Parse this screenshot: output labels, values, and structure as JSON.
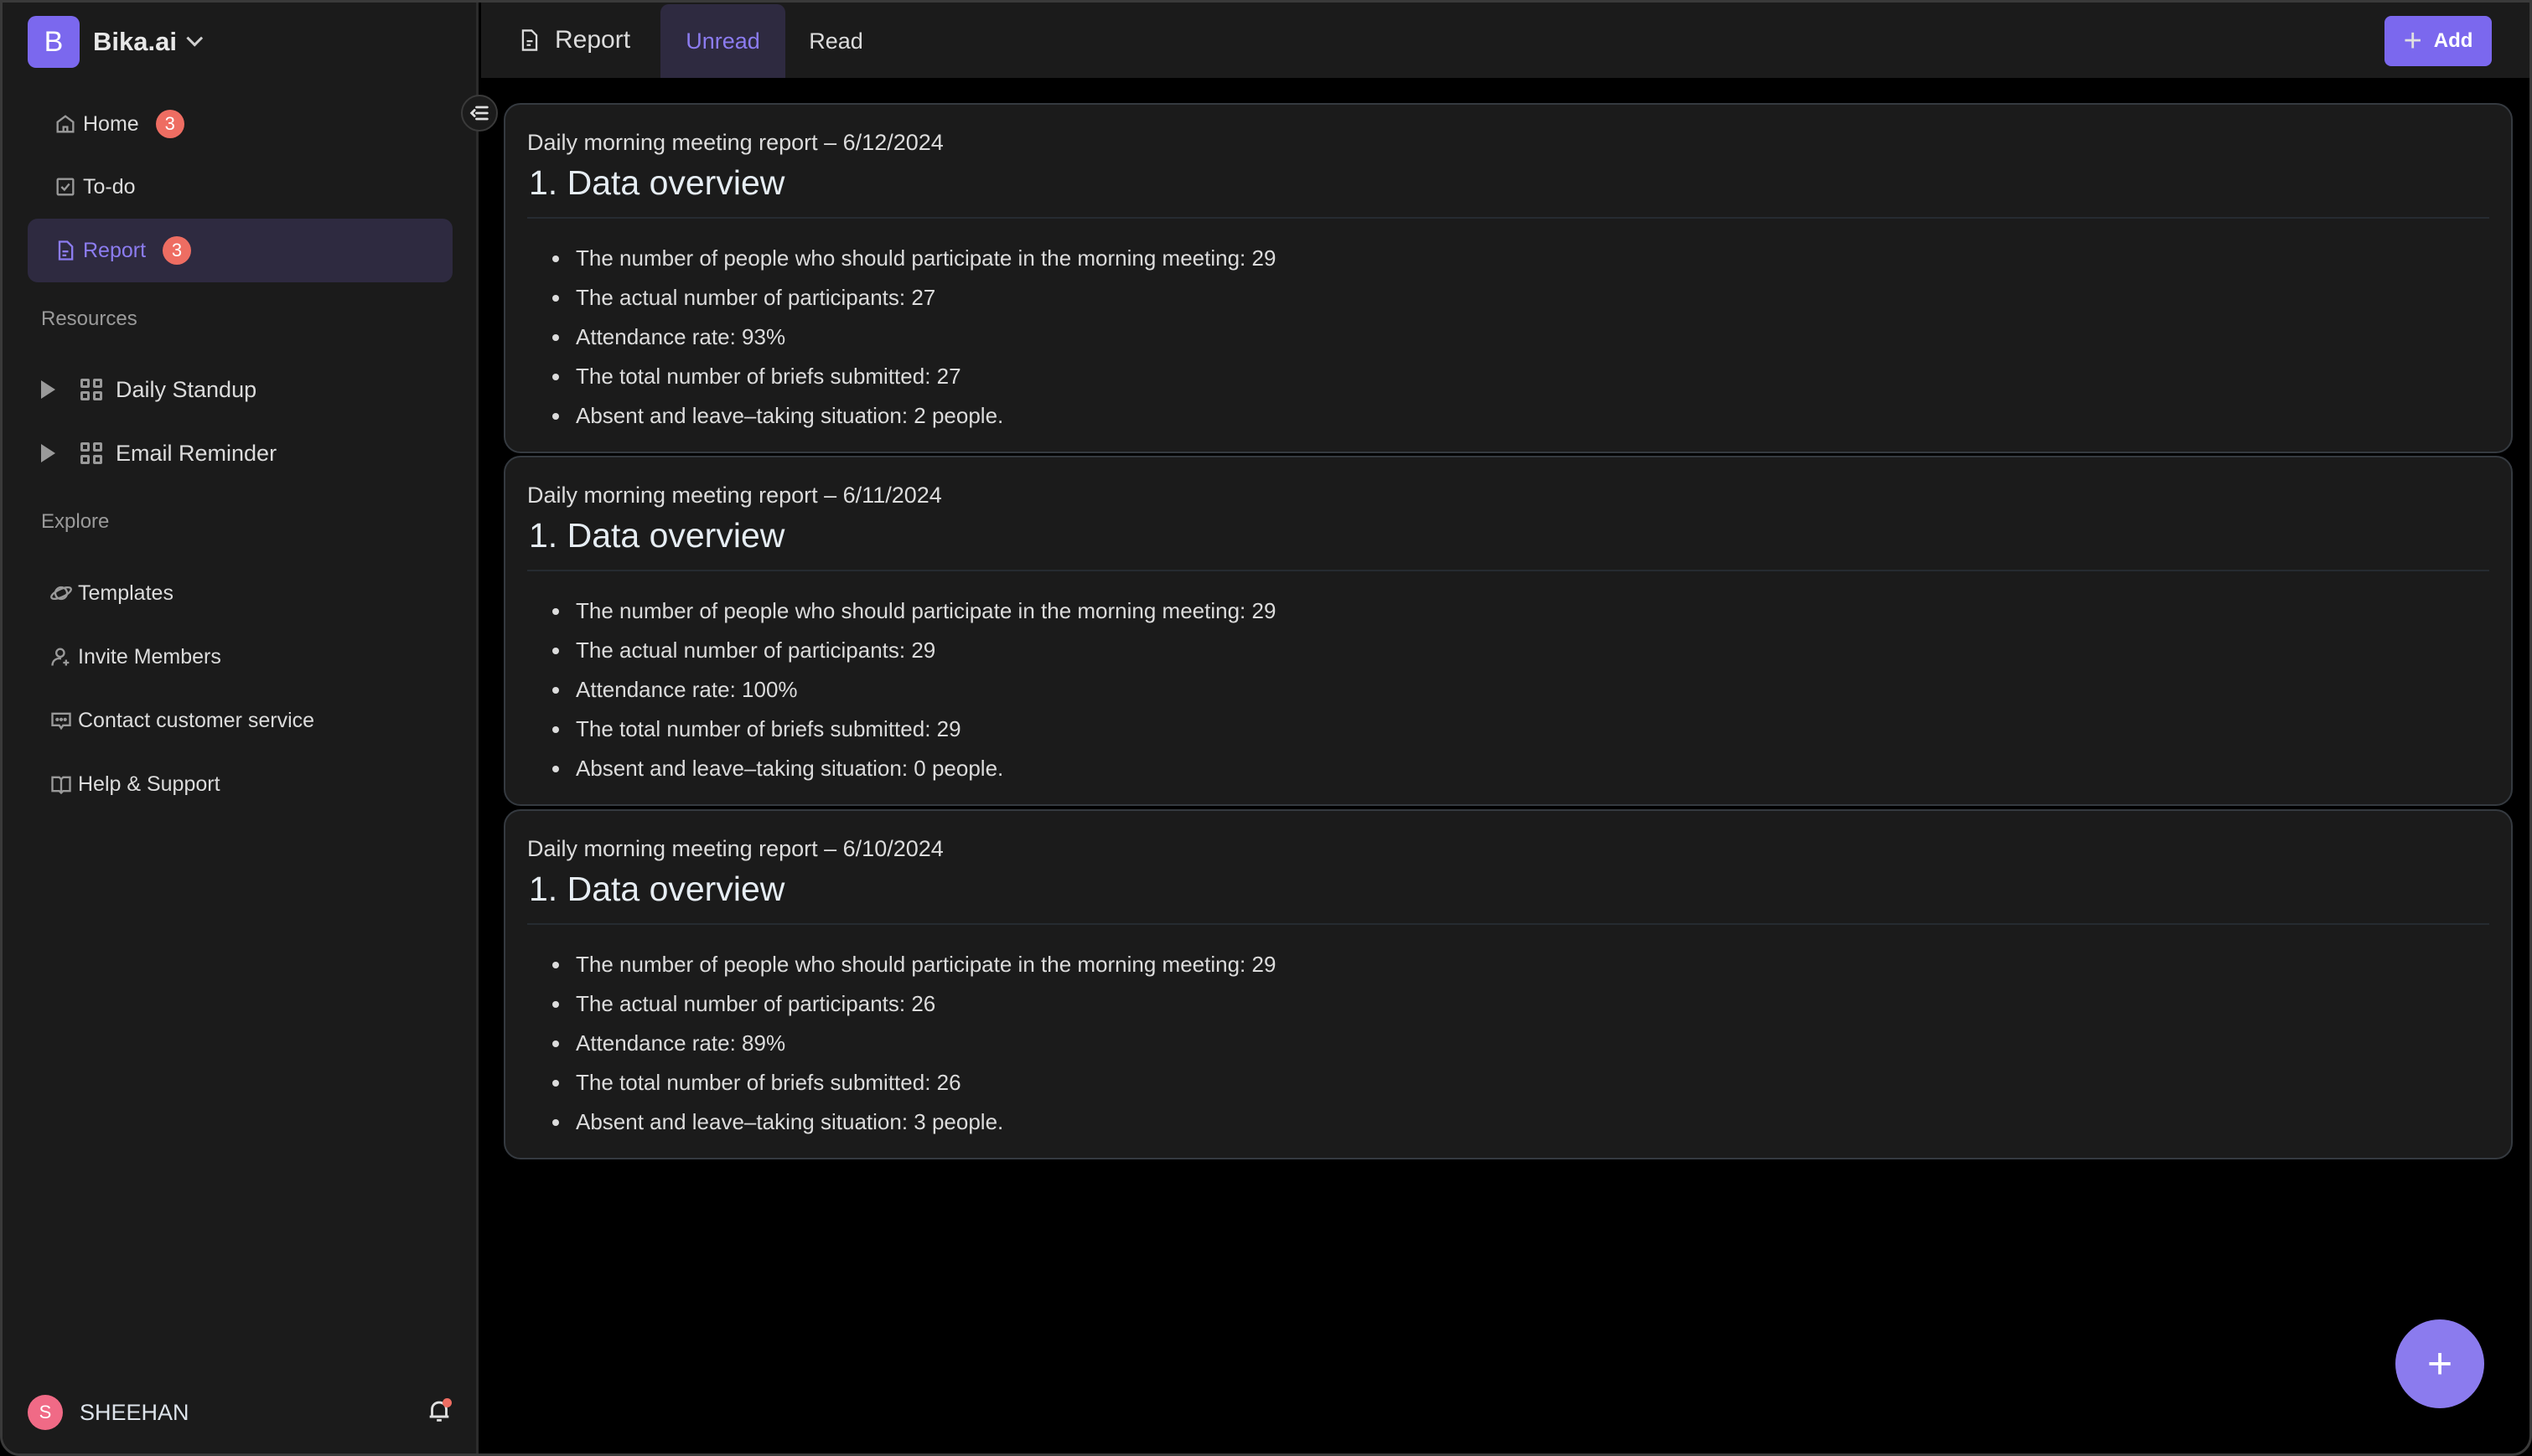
{
  "workspace": {
    "logo_letter": "B",
    "name": "Bika.ai"
  },
  "sidebar": {
    "nav": [
      {
        "label": "Home",
        "badge": "3",
        "icon": "home-icon"
      },
      {
        "label": "To-do",
        "icon": "checkbox-icon"
      },
      {
        "label": "Report",
        "badge": "3",
        "icon": "document-icon",
        "active": true
      }
    ],
    "resources_label": "Resources",
    "resources": [
      {
        "label": "Daily Standup",
        "icon": "grid-icon"
      },
      {
        "label": "Email Reminder",
        "icon": "grid-icon"
      }
    ],
    "explore_label": "Explore",
    "explore": [
      {
        "label": "Templates",
        "icon": "planet-icon"
      },
      {
        "label": "Invite Members",
        "icon": "user-plus-icon"
      },
      {
        "label": "Contact customer service",
        "icon": "chat-icon"
      },
      {
        "label": "Help & Support",
        "icon": "book-icon"
      }
    ],
    "user": {
      "initial": "S",
      "name": "SHEEHAN",
      "has_notification": true
    }
  },
  "header": {
    "title": "Report",
    "tabs": [
      {
        "label": "Unread",
        "active": true
      },
      {
        "label": "Read",
        "active": false
      }
    ],
    "add_label": "Add"
  },
  "reports": [
    {
      "title": "Daily morning meeting report – 6/12/2024",
      "heading": "1. Data overview",
      "items": [
        "The number of people who should participate in the morning meeting: 29",
        "The actual number of participants: 27",
        "Attendance rate: 93%",
        "The total number of briefs submitted: 27",
        "Absent and leave–taking situation: 2 people."
      ]
    },
    {
      "title": "Daily morning meeting report – 6/11/2024",
      "heading": "1. Data overview",
      "items": [
        "The number of people who should participate in the morning meeting: 29",
        "The actual number of participants: 29",
        "Attendance rate: 100%",
        "The total number of briefs submitted: 29",
        "Absent and leave–taking situation: 0 people."
      ]
    },
    {
      "title": "Daily morning meeting report – 6/10/2024",
      "heading": "1. Data overview",
      "items": [
        "The number of people who should participate in the morning meeting: 29",
        "The actual number of participants: 26",
        "Attendance rate: 89%",
        "The total number of briefs submitted: 26",
        "Absent and leave–taking situation: 3 people."
      ]
    }
  ],
  "fab": {
    "symbol": "+"
  },
  "colors": {
    "accent": "#7b68ee",
    "badge": "#ee6d62",
    "avatar": "#f06a86",
    "active_bg": "#2e2a40",
    "active_text": "#8c7cf0"
  }
}
